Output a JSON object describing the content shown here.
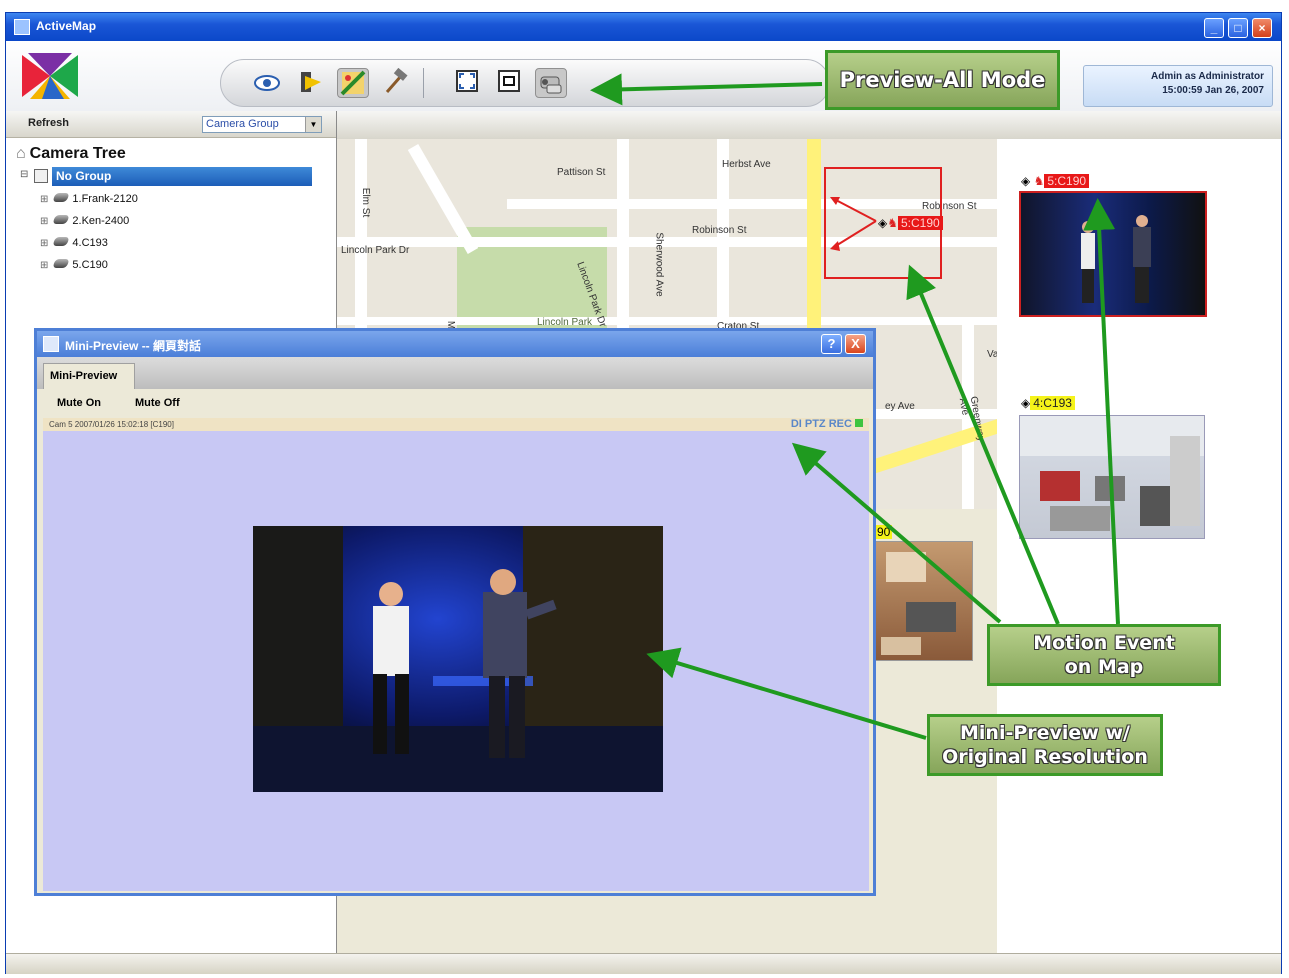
{
  "window": {
    "title": "ActiveMap"
  },
  "toolbar": {
    "tools": [
      "eye-icon",
      "bookmark-icon",
      "map-edit-icon",
      "hammer-icon",
      "fullscreen-icon",
      "rotate-icon",
      "camera-preview-icon"
    ]
  },
  "user": {
    "line1": "Admin as Administrator",
    "line2": "15:00:59 Jan 26, 2007"
  },
  "left_panel": {
    "refresh": "Refresh",
    "group_select": "Camera Group",
    "tree_title": "Camera Tree",
    "group_name": "No Group",
    "cameras": [
      "1.Frank-2120",
      "2.Ken-2400",
      "4.C193",
      "5.C190"
    ]
  },
  "map": {
    "streets": [
      "Pattison St",
      "Herbst Ave",
      "Robinson St",
      "Robinson St",
      "Lincoln Park Dr",
      "Elm St",
      "Lincoln Park Dr",
      "Sherwood Ave",
      "Lincoln Park",
      "Craton St",
      "Va",
      "ey Ave",
      "Greenway Ave",
      "Maple"
    ],
    "motion_label": "5:C190"
  },
  "right_thumbs": {
    "cam1": "5:C190",
    "cam2": "4:C193",
    "cam3_partial": "90"
  },
  "mini_preview": {
    "title": "Mini-Preview -- 網頁對話",
    "tab": "Mini-Preview",
    "mute_on": "Mute On",
    "mute_off": "Mute Off",
    "status_text": "Cam 5 2007/01/26 15:02:18 [C190]",
    "status_right": "DI PTZ REC",
    "help": "?",
    "close": "X"
  },
  "callouts": {
    "preview_all": "Preview-All Mode",
    "motion_event": [
      "Motion Event",
      "on Map"
    ],
    "mini_preview": [
      "Mini-Preview w/",
      "Original Resolution"
    ]
  },
  "colors": {
    "callout_border": "#3c9a28",
    "arrow": "#1f9a1f",
    "motion_red": "#e81818",
    "highlight_yellow": "#f5f31a"
  }
}
